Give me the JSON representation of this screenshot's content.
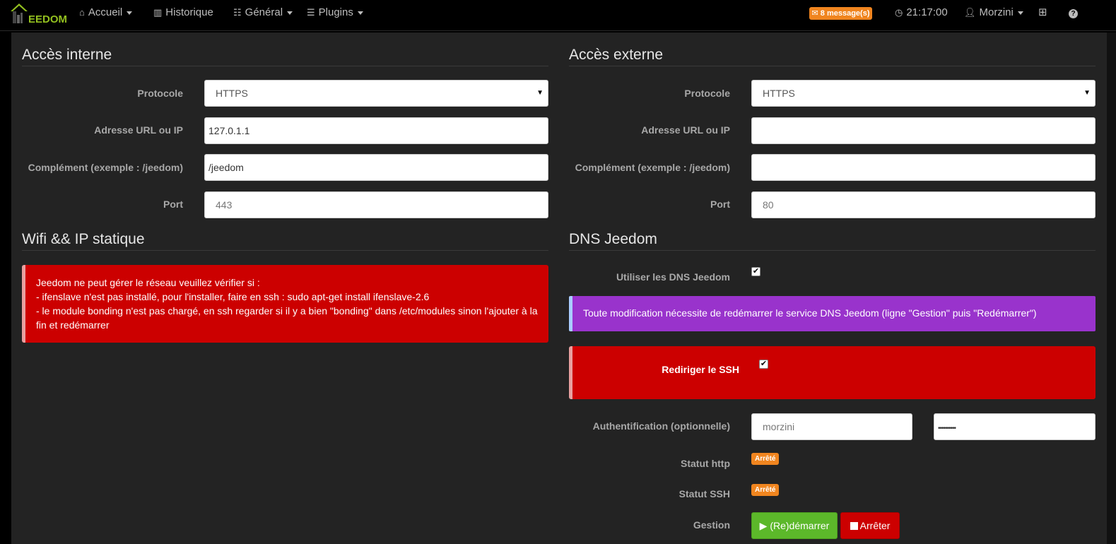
{
  "navbar": {
    "logo_text": "EEDOM",
    "items": [
      {
        "label": "Accueil",
        "icon": "home-icon"
      },
      {
        "label": "Historique",
        "icon": "bar-chart-icon"
      },
      {
        "label": "Général",
        "icon": "list-icon"
      },
      {
        "label": "Plugins",
        "icon": "tasks-icon"
      }
    ],
    "messages_badge": "8 message(s)",
    "clock": "21:17:00",
    "user": "Morzini"
  },
  "internal": {
    "title": "Accès interne",
    "protocol_label": "Protocole",
    "protocol_value": "HTTPS",
    "url_label": "Adresse URL ou IP",
    "url_value": "127.0.1.1",
    "complement_label": "Complément (exemple : /jeedom)",
    "complement_value": "/jeedom",
    "port_label": "Port",
    "port_placeholder": "443"
  },
  "external": {
    "title": "Accès externe",
    "protocol_label": "Protocole",
    "protocol_value": "HTTPS",
    "url_label": "Adresse URL ou IP",
    "url_value": "",
    "complement_label": "Complément (exemple : /jeedom)",
    "complement_value": "",
    "port_label": "Port",
    "port_placeholder": "80"
  },
  "wifi": {
    "title": "Wifi && IP statique",
    "alert_lines": [
      "Jeedom ne peut gérer le réseau veuillez vérifier si :",
      "- ifenslave n'est pas installé, pour l'installer, faire en ssh : sudo apt-get install ifenslave-2.6",
      "- le module bonding n'est pas chargé, en ssh regarder si il y a bien \"bonding\" dans /etc/modules sinon l'ajouter à la",
      "fin et redémarrer"
    ]
  },
  "dns": {
    "title": "DNS Jeedom",
    "use_dns_label": "Utiliser les DNS Jeedom",
    "use_dns_checked": true,
    "info": "Toute modification nécessite de redémarrer le service DNS Jeedom (ligne \"Gestion\" puis \"Redémarrer\")",
    "redirect_ssh_label": "Rediriger le SSH",
    "redirect_ssh_checked": true,
    "auth_label": "Authentification (optionnelle)",
    "auth_user_placeholder": "morzini",
    "auth_password_value": "••••••••••",
    "status_http_label": "Statut http",
    "status_http_value": "Arrêté",
    "status_ssh_label": "Statut SSH",
    "status_ssh_value": "Arrêté",
    "gestion_label": "Gestion",
    "restart_button": "(Re)démarrer",
    "stop_button": "Arrêter"
  },
  "colors": {
    "accent_green": "#93c01f",
    "badge_orange": "#f0851f",
    "alert_red": "#cc0000",
    "info_purple": "#9933cc",
    "button_green": "#5cb82a"
  }
}
